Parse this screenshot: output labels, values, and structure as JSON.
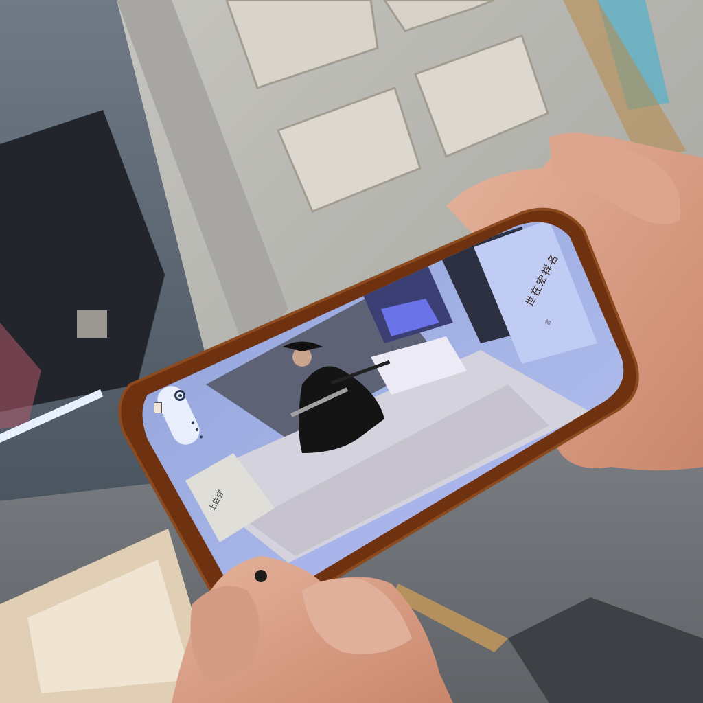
{
  "scene": {
    "description_free": true,
    "subject": "hand-held-smartphone-ar-view"
  },
  "phone_screen": {
    "title_vertical": "世在宏祥名",
    "subtitle_vertical": "言",
    "left_label": "土佐弥",
    "icons": [
      "camera-pill-icon",
      "more-dots-icon",
      "record-icon",
      "back-icon"
    ]
  },
  "colors": {
    "wall": "#b8b6b0",
    "phone_case": "#7a3a12",
    "screen_sky": "#aab6f0",
    "floor_tatami": "#c7c8dc",
    "figure": "#111111",
    "skin": "#d9a38a"
  }
}
